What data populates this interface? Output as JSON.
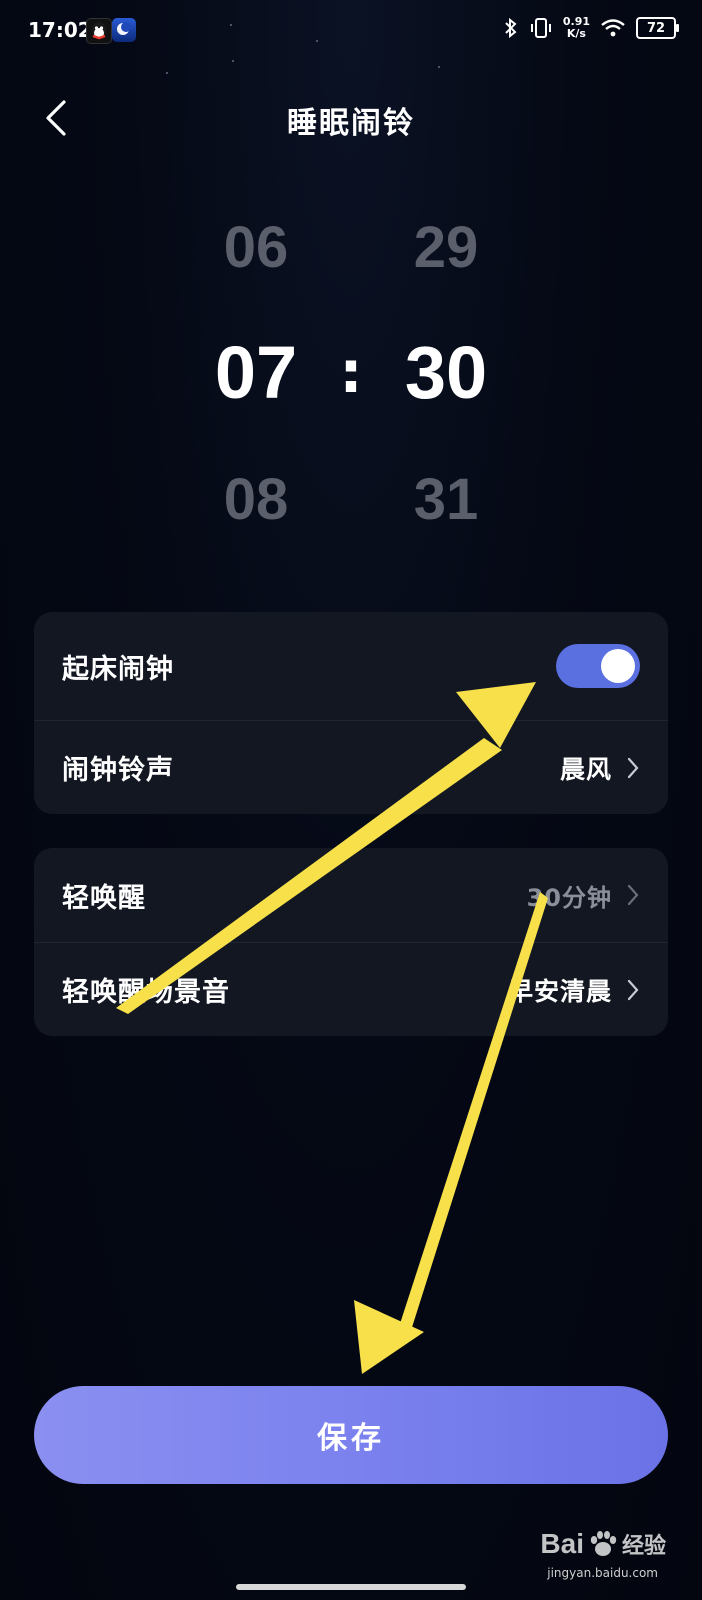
{
  "status_bar": {
    "time": "17:02",
    "speed_value": "0.91",
    "speed_unit": "K/s",
    "battery": "72"
  },
  "header": {
    "title": "睡眠闹铃",
    "back_icon": "chevron-left-icon"
  },
  "time_picker": {
    "hours": {
      "prev": "06",
      "selected": "07",
      "next": "08"
    },
    "separator": ":",
    "minutes": {
      "prev": "29",
      "selected": "30",
      "next": "31"
    }
  },
  "alarm_card": {
    "wake_alarm_label": "起床闹钟",
    "wake_alarm_on": true,
    "ringtone_label": "闹钟铃声",
    "ringtone_value": "晨风"
  },
  "gentle_card": {
    "gentle_wake_label": "轻唤醒",
    "gentle_wake_value": "30分钟",
    "scene_sound_label": "轻唤醒场景音",
    "scene_sound_value": "早安清晨"
  },
  "save_button": {
    "label": "保存"
  },
  "watermark": {
    "brand": "Bai",
    "suffix": "经验",
    "url": "jingyan.baidu.com"
  },
  "colors": {
    "accent": "#5a6fe0",
    "save_gradient_start": "#8a8ff0",
    "save_gradient_end": "#6a72e6",
    "annotation_arrow": "#f7e04a"
  }
}
